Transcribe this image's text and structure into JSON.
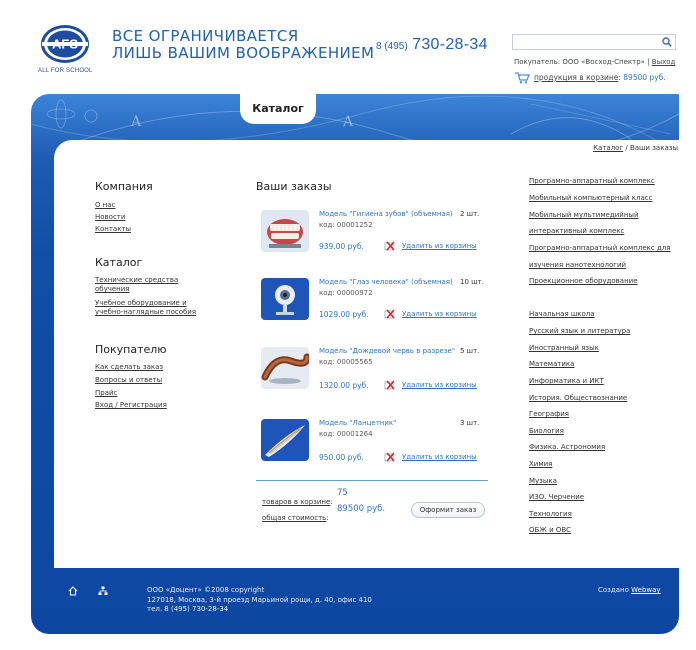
{
  "header": {
    "logo_text": "AFS",
    "logo_caption": "ALL FOR SCHOOL",
    "slogan_line1": "ВСЕ ОГРАНИЧИВАЕТСЯ",
    "slogan_line2": "ЛИШЬ ВАШИМ ВООБРАЖЕНИЕМ",
    "phone_prefix": "8 (495)",
    "phone_number": "730-28-34",
    "search_value": "",
    "buyer_label": "Покупатель:",
    "buyer_name": "ООО «Восход-Спектр»",
    "separator": "|",
    "logout": "Выход",
    "cart_link": "продукция в корзине",
    "cart_colon": ":",
    "cart_sum": "89500 руб."
  },
  "tab": {
    "label": "Каталог"
  },
  "breadcrumb": {
    "link": "Каталог",
    "sep": " / ",
    "current": "Ваши заказы"
  },
  "left_nav": {
    "company": {
      "title": "Компания",
      "items": [
        "О нас",
        "Новости",
        "Контакты"
      ]
    },
    "catalog": {
      "title": "Каталог",
      "items": [
        "Технические средства",
        "обучения",
        "Учебное оборудование и",
        "учебно-наглядные пособия"
      ]
    },
    "buyer": {
      "title": "Покупателю",
      "items": [
        "Как сделать заказ",
        "Вопросы и ответы",
        "Прайс",
        "Вход / Регистрация"
      ]
    }
  },
  "orders": {
    "title": "Ваши заказы",
    "delete_label": "Удалить из корзины",
    "items": [
      {
        "name": "Модель \"Гигиена зубов\" (объемная)",
        "code": "код: 00001252",
        "qty": "2 шт.",
        "price": "939.00 руб."
      },
      {
        "name": "Модель \"Глаз человека\" (объемная)",
        "code": "код: 00000972",
        "qty": "10 шт.",
        "price": "1029.00 руб."
      },
      {
        "name": "Модель \"Дождевой червь в разрезе\"",
        "code": "код: 00005565",
        "qty": "5 шт.",
        "price": "1320.00 руб."
      },
      {
        "name": "Модель \"Ланцетник\"",
        "code": "код: 00001264",
        "qty": "3 шт.",
        "price": "950.00 руб."
      }
    ],
    "totals": {
      "count_label": "товаров в корзине",
      "count_colon": ":",
      "count_value": "75",
      "sum_label": "общая стоимость",
      "sum_colon": ":",
      "sum_value": "89500 руб.",
      "checkout": "Оформит заказ"
    }
  },
  "right_nav": {
    "group1": [
      "Програмно-аппаратный комплекс",
      "Мобильный компьютерный класс",
      "Мобильный мультимедийный",
      "интерактивный комплекс",
      "Програмно-аппаратный комплекс для",
      "изучения нанотехнологий",
      "Проекционное оборудование"
    ],
    "group2": [
      "Начальная школа",
      "Русский язык и литература",
      "Иностранный язык",
      "Математика",
      "Информатика и ИКТ",
      "История. Обществознание",
      "География",
      "Биология",
      "Физика. Астрономия",
      "Химия",
      "Музыка",
      "ИЗО. Черчение",
      "Технология",
      "ОБЖ и ОВС"
    ]
  },
  "footer": {
    "line1": "ООО «Доцент» ©2008 copyright",
    "line2": "127018, Москва, 3-й проезд Марьиной рощи, д. 40, офис 410",
    "line3": "тел. 8 (495) 730-28-34",
    "created_label": "Создано",
    "created_link": "Webway"
  },
  "colors": {
    "brand_blue": "#0d47a1",
    "link_blue": "#2a74c7",
    "text": "#333333"
  }
}
